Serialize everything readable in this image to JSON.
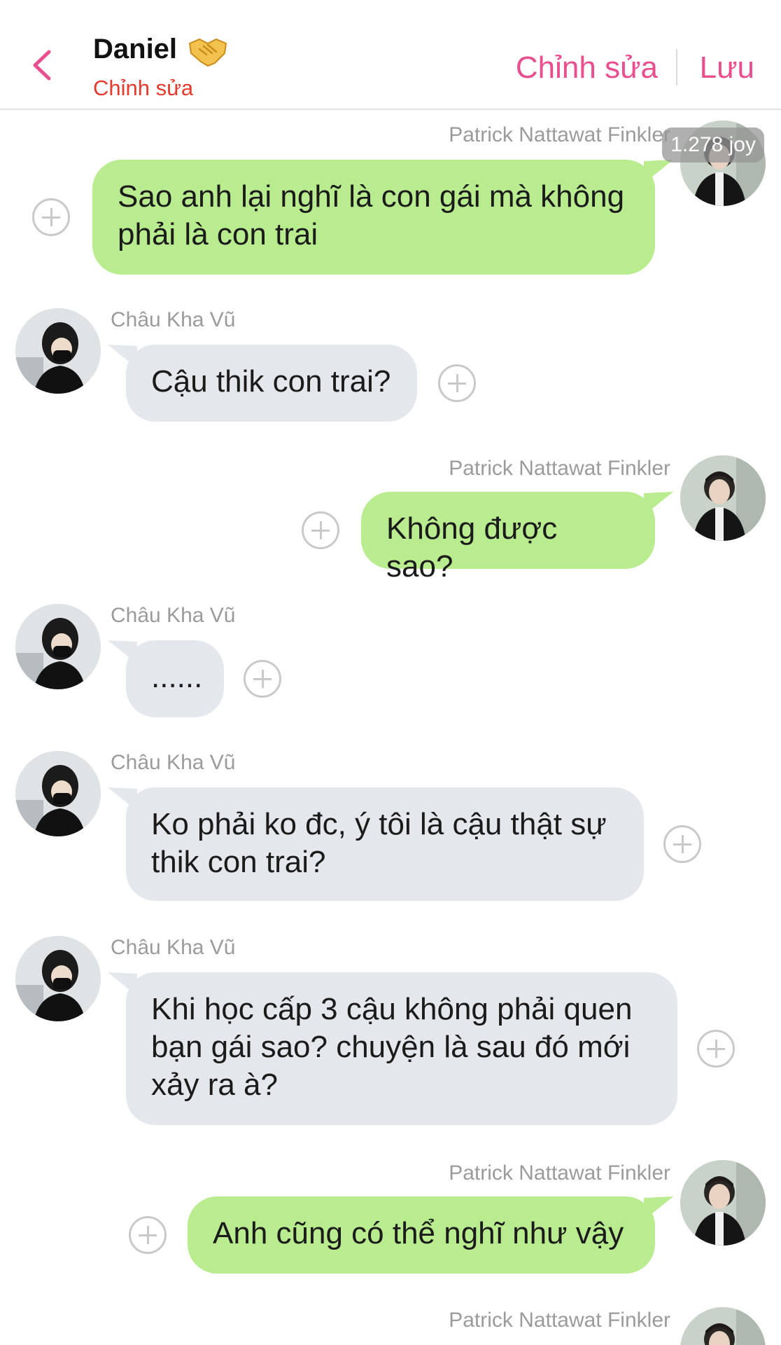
{
  "header": {
    "title": "Daniel",
    "subtitle": "Chỉnh sửa",
    "edit_label": "Chỉnh sửa",
    "save_label": "Lưu"
  },
  "badge": {
    "text": "1.278 joy"
  },
  "messages": [
    {
      "sender": "Patrick Nattawat Finkler",
      "line1": "Sao anh lại nghĩ là con gái mà không",
      "line2": "phải là con trai"
    },
    {
      "sender": "Châu Kha Vũ",
      "line1": "Cậu thik con trai?"
    },
    {
      "sender": "Patrick Nattawat Finkler",
      "line1": "Không được sao?"
    },
    {
      "sender": "Châu Kha Vũ",
      "line1": "......"
    },
    {
      "sender": "Châu Kha Vũ",
      "line1": "Ko phải ko đc, ý tôi là cậu thật sự",
      "line2": "thik con trai?"
    },
    {
      "sender": "Châu Kha Vũ",
      "line1": "Khi học cấp 3 cậu không phải quen",
      "line2": "bạn gái sao? chuyện là sau đó mới",
      "line3": "xảy ra à?"
    },
    {
      "sender": "Patrick Nattawat Finkler",
      "line1": "Anh cũng có thể nghĩ như vậy"
    },
    {
      "sender": "Patrick Nattawat Finkler"
    }
  ]
}
